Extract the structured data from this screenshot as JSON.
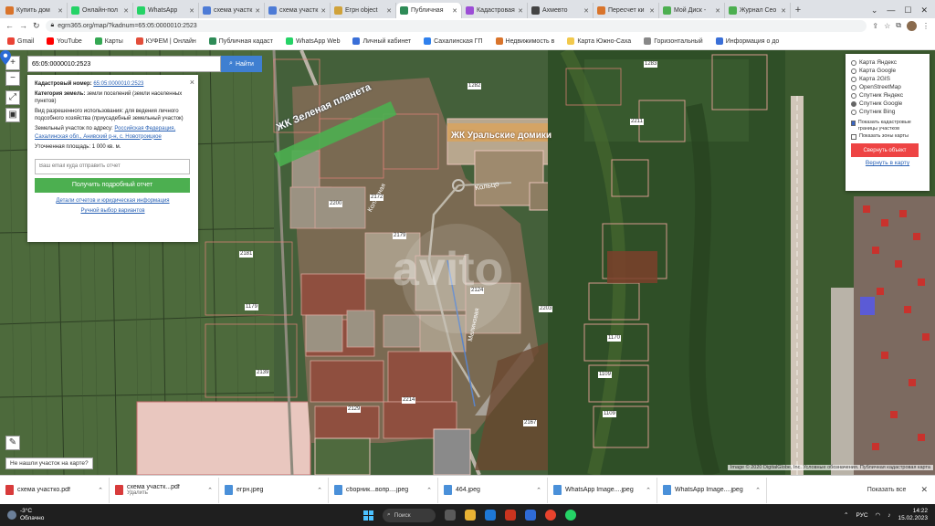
{
  "tabs": [
    {
      "label": "Купить дом",
      "color": "#d9742b"
    },
    {
      "label": "Онлайн-пол",
      "color": "#25d366"
    },
    {
      "label": "WhatsApp",
      "color": "#25d366"
    },
    {
      "label": "схема участк",
      "color": "#4d7bd6"
    },
    {
      "label": "схема участк",
      "color": "#4d7bd6"
    },
    {
      "label": "Егрн object",
      "color": "#d0a23a"
    },
    {
      "label": "Публичная",
      "color": "#2e8b57",
      "active": true
    },
    {
      "label": "Кадастровая",
      "color": "#9c4dd6"
    },
    {
      "label": "Ахмевто",
      "color": "#444444"
    },
    {
      "label": "Пересчет ки",
      "color": "#d9742b"
    },
    {
      "label": "Мой Диск -",
      "color": "#4caf50"
    },
    {
      "label": "Журнал Сео",
      "color": "#4caf50"
    }
  ],
  "address": {
    "url": "egrn365.org/map/?kadnum=65:05:0000010:2523",
    "back": "←",
    "forward": "→",
    "reload": "↻"
  },
  "bookmarks": [
    {
      "label": "Gmail",
      "color": "#ea4335"
    },
    {
      "label": "YouTube",
      "color": "#ff0000"
    },
    {
      "label": "Карты",
      "color": "#34a853"
    },
    {
      "label": "КУФЕМ | Онлайн",
      "color": "#e34e3b"
    },
    {
      "label": "Публичная кадаст",
      "color": "#2e8b57"
    },
    {
      "label": "WhatsApp Web",
      "color": "#25d366"
    },
    {
      "label": "Личный кабинет",
      "color": "#3a6fd8"
    },
    {
      "label": "Сахалинская ГП",
      "color": "#2f80ed"
    },
    {
      "label": "Недвижимость в",
      "color": "#d9742b"
    },
    {
      "label": "Карта Южно-Саха",
      "color": "#f2c94c"
    },
    {
      "label": "Горизонтальный",
      "color": "#888888"
    },
    {
      "label": "Информация о до",
      "color": "#3a6fd8"
    }
  ],
  "map": {
    "search_value": "65:05:0000010:2523",
    "search_button": "Найти",
    "zoom_in": "+",
    "zoom_out": "−",
    "ruler": "⤢",
    "print": "▣",
    "edit": "✎",
    "labels": {
      "area1": "ЖК Зеленая планета",
      "area2": "ЖК Уральские домики",
      "street1": "Колхозная",
      "street2": "Малиновая",
      "street3": "Кольцо",
      "watermark": "avito"
    },
    "parcel_numbers": [
      "1282",
      "2211",
      "2200",
      "2172",
      "2179",
      "2181",
      "1179",
      "2124",
      "2214",
      "2139",
      "2129",
      "1283",
      "2203",
      "1170",
      "1109",
      "1109",
      "2167"
    ],
    "attribution": "Image © 2020 DigitalGlobe, Inc. Условные обозначения. Публичная кадастровая карта",
    "prompt_text": "Не нашли участок на карте?"
  },
  "info_panel": {
    "close": "×",
    "cad_label": "Кадастровый номер:",
    "cad_value": "65:05:0000010:2523",
    "category_label": "Категория земель:",
    "category_value": "земли поселений (земли населенных пунктов)",
    "use_label": "Вид разрешенного использования:",
    "use_value": "для ведения личного подсобного хозяйства (приусадебный земельный участок)",
    "location_label": "Земельный участок по адресу:",
    "location_value": "Российская Федерация, Сахалинская обл., Анивский р-н, с. Новотроицкое",
    "area_label": "Уточненная площадь:",
    "area_value": "1 000 кв. м.",
    "email_placeholder": "Ваш email куда отправить отчет",
    "order_button": "Получить подробный отчет",
    "link1": "Детали отчетов и юридическая информация",
    "link2": "Ручной выбор вариантов"
  },
  "layers_panel": {
    "options": [
      {
        "label": "Карта Яндекс",
        "on": false
      },
      {
        "label": "Карта Google",
        "on": false
      },
      {
        "label": "Карта 2GIS",
        "on": false
      },
      {
        "label": "OpenStreetMap",
        "on": false
      },
      {
        "label": "Спутник Яндекс",
        "on": false
      },
      {
        "label": "Спутник Google",
        "on": true
      },
      {
        "label": "Спутник Bing",
        "on": false
      }
    ],
    "check1": "Показать кадастровые границы участков",
    "check2": "Показать зоны карты",
    "red_button": "Свернуть объект",
    "link": "Вернуть в карту"
  },
  "downloads": [
    {
      "name": "схема участко.pdf",
      "sub": "",
      "color": "#d83b3b"
    },
    {
      "name": "схема участк...pdf",
      "sub": "Удалить",
      "color": "#d83b3b"
    },
    {
      "name": "егрн.jpeg",
      "sub": "",
      "color": "#4a90d9"
    },
    {
      "name": "сборник...вопр....jpeg",
      "sub": "",
      "color": "#4a90d9"
    },
    {
      "name": "464.jpeg",
      "sub": "",
      "color": "#4a90d9"
    },
    {
      "name": "WhatsApp Image....jpeg",
      "sub": "",
      "color": "#4a90d9"
    },
    {
      "name": "WhatsApp Image....jpeg",
      "sub": "",
      "color": "#4a90d9"
    }
  ],
  "downloads_showall": "Показать все",
  "taskbar": {
    "temp": "-3°C",
    "weather": "Облачно",
    "search": "Поиск",
    "time": "14:22",
    "date": "15.02.2023",
    "lang": "РУС"
  }
}
